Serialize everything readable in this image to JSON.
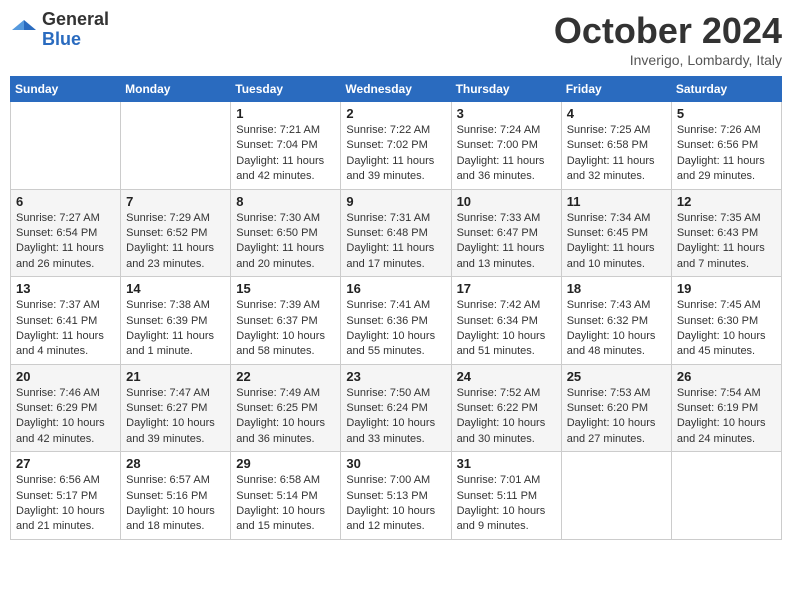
{
  "logo": {
    "general": "General",
    "blue": "Blue"
  },
  "title": "October 2024",
  "location": "Inverigo, Lombardy, Italy",
  "days_of_week": [
    "Sunday",
    "Monday",
    "Tuesday",
    "Wednesday",
    "Thursday",
    "Friday",
    "Saturday"
  ],
  "weeks": [
    [
      null,
      null,
      {
        "day": 1,
        "sunrise": "7:21 AM",
        "sunset": "7:04 PM",
        "daylight": "11 hours and 42 minutes."
      },
      {
        "day": 2,
        "sunrise": "7:22 AM",
        "sunset": "7:02 PM",
        "daylight": "11 hours and 39 minutes."
      },
      {
        "day": 3,
        "sunrise": "7:24 AM",
        "sunset": "7:00 PM",
        "daylight": "11 hours and 36 minutes."
      },
      {
        "day": 4,
        "sunrise": "7:25 AM",
        "sunset": "6:58 PM",
        "daylight": "11 hours and 32 minutes."
      },
      {
        "day": 5,
        "sunrise": "7:26 AM",
        "sunset": "6:56 PM",
        "daylight": "11 hours and 29 minutes."
      }
    ],
    [
      {
        "day": 6,
        "sunrise": "7:27 AM",
        "sunset": "6:54 PM",
        "daylight": "11 hours and 26 minutes."
      },
      {
        "day": 7,
        "sunrise": "7:29 AM",
        "sunset": "6:52 PM",
        "daylight": "11 hours and 23 minutes."
      },
      {
        "day": 8,
        "sunrise": "7:30 AM",
        "sunset": "6:50 PM",
        "daylight": "11 hours and 20 minutes."
      },
      {
        "day": 9,
        "sunrise": "7:31 AM",
        "sunset": "6:48 PM",
        "daylight": "11 hours and 17 minutes."
      },
      {
        "day": 10,
        "sunrise": "7:33 AM",
        "sunset": "6:47 PM",
        "daylight": "11 hours and 13 minutes."
      },
      {
        "day": 11,
        "sunrise": "7:34 AM",
        "sunset": "6:45 PM",
        "daylight": "11 hours and 10 minutes."
      },
      {
        "day": 12,
        "sunrise": "7:35 AM",
        "sunset": "6:43 PM",
        "daylight": "11 hours and 7 minutes."
      }
    ],
    [
      {
        "day": 13,
        "sunrise": "7:37 AM",
        "sunset": "6:41 PM",
        "daylight": "11 hours and 4 minutes."
      },
      {
        "day": 14,
        "sunrise": "7:38 AM",
        "sunset": "6:39 PM",
        "daylight": "11 hours and 1 minute."
      },
      {
        "day": 15,
        "sunrise": "7:39 AM",
        "sunset": "6:37 PM",
        "daylight": "10 hours and 58 minutes."
      },
      {
        "day": 16,
        "sunrise": "7:41 AM",
        "sunset": "6:36 PM",
        "daylight": "10 hours and 55 minutes."
      },
      {
        "day": 17,
        "sunrise": "7:42 AM",
        "sunset": "6:34 PM",
        "daylight": "10 hours and 51 minutes."
      },
      {
        "day": 18,
        "sunrise": "7:43 AM",
        "sunset": "6:32 PM",
        "daylight": "10 hours and 48 minutes."
      },
      {
        "day": 19,
        "sunrise": "7:45 AM",
        "sunset": "6:30 PM",
        "daylight": "10 hours and 45 minutes."
      }
    ],
    [
      {
        "day": 20,
        "sunrise": "7:46 AM",
        "sunset": "6:29 PM",
        "daylight": "10 hours and 42 minutes."
      },
      {
        "day": 21,
        "sunrise": "7:47 AM",
        "sunset": "6:27 PM",
        "daylight": "10 hours and 39 minutes."
      },
      {
        "day": 22,
        "sunrise": "7:49 AM",
        "sunset": "6:25 PM",
        "daylight": "10 hours and 36 minutes."
      },
      {
        "day": 23,
        "sunrise": "7:50 AM",
        "sunset": "6:24 PM",
        "daylight": "10 hours and 33 minutes."
      },
      {
        "day": 24,
        "sunrise": "7:52 AM",
        "sunset": "6:22 PM",
        "daylight": "10 hours and 30 minutes."
      },
      {
        "day": 25,
        "sunrise": "7:53 AM",
        "sunset": "6:20 PM",
        "daylight": "10 hours and 27 minutes."
      },
      {
        "day": 26,
        "sunrise": "7:54 AM",
        "sunset": "6:19 PM",
        "daylight": "10 hours and 24 minutes."
      }
    ],
    [
      {
        "day": 27,
        "sunrise": "6:56 AM",
        "sunset": "5:17 PM",
        "daylight": "10 hours and 21 minutes."
      },
      {
        "day": 28,
        "sunrise": "6:57 AM",
        "sunset": "5:16 PM",
        "daylight": "10 hours and 18 minutes."
      },
      {
        "day": 29,
        "sunrise": "6:58 AM",
        "sunset": "5:14 PM",
        "daylight": "10 hours and 15 minutes."
      },
      {
        "day": 30,
        "sunrise": "7:00 AM",
        "sunset": "5:13 PM",
        "daylight": "10 hours and 12 minutes."
      },
      {
        "day": 31,
        "sunrise": "7:01 AM",
        "sunset": "5:11 PM",
        "daylight": "10 hours and 9 minutes."
      },
      null,
      null
    ]
  ],
  "labels": {
    "sunrise": "Sunrise:",
    "sunset": "Sunset:",
    "daylight": "Daylight:"
  }
}
